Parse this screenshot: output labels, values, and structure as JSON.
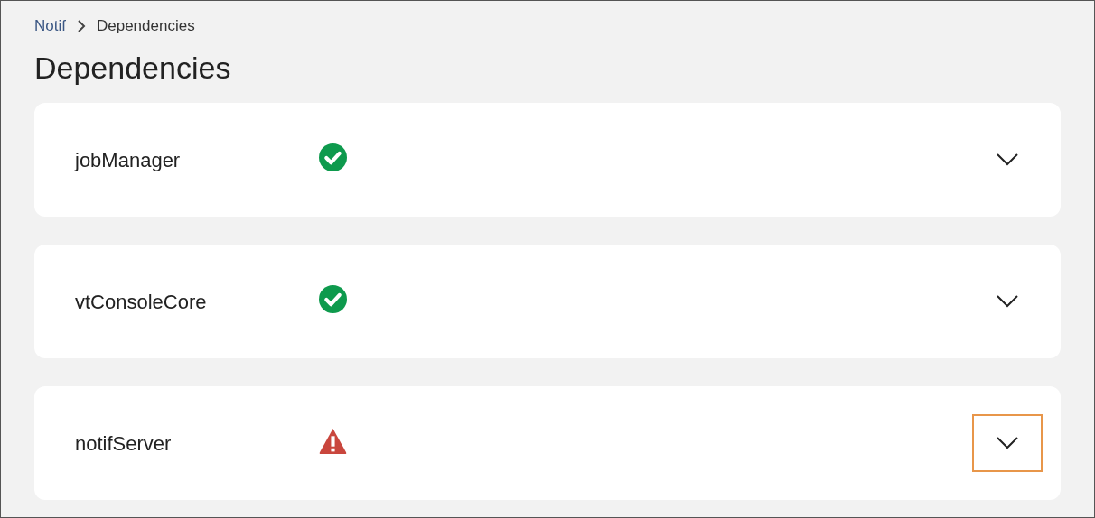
{
  "breadcrumb": [
    {
      "label": "Notif",
      "kind": "link"
    },
    {
      "label": "Dependencies",
      "kind": "current"
    }
  ],
  "title": "Dependencies",
  "dependencies": [
    {
      "name": "jobManager",
      "kind": "ok",
      "expanded": false,
      "highlighted": false
    },
    {
      "name": "vtConsoleCore",
      "kind": "ok",
      "expanded": false,
      "highlighted": false
    },
    {
      "name": "notifServer",
      "kind": "warning",
      "expanded": false,
      "highlighted": true
    }
  ]
}
